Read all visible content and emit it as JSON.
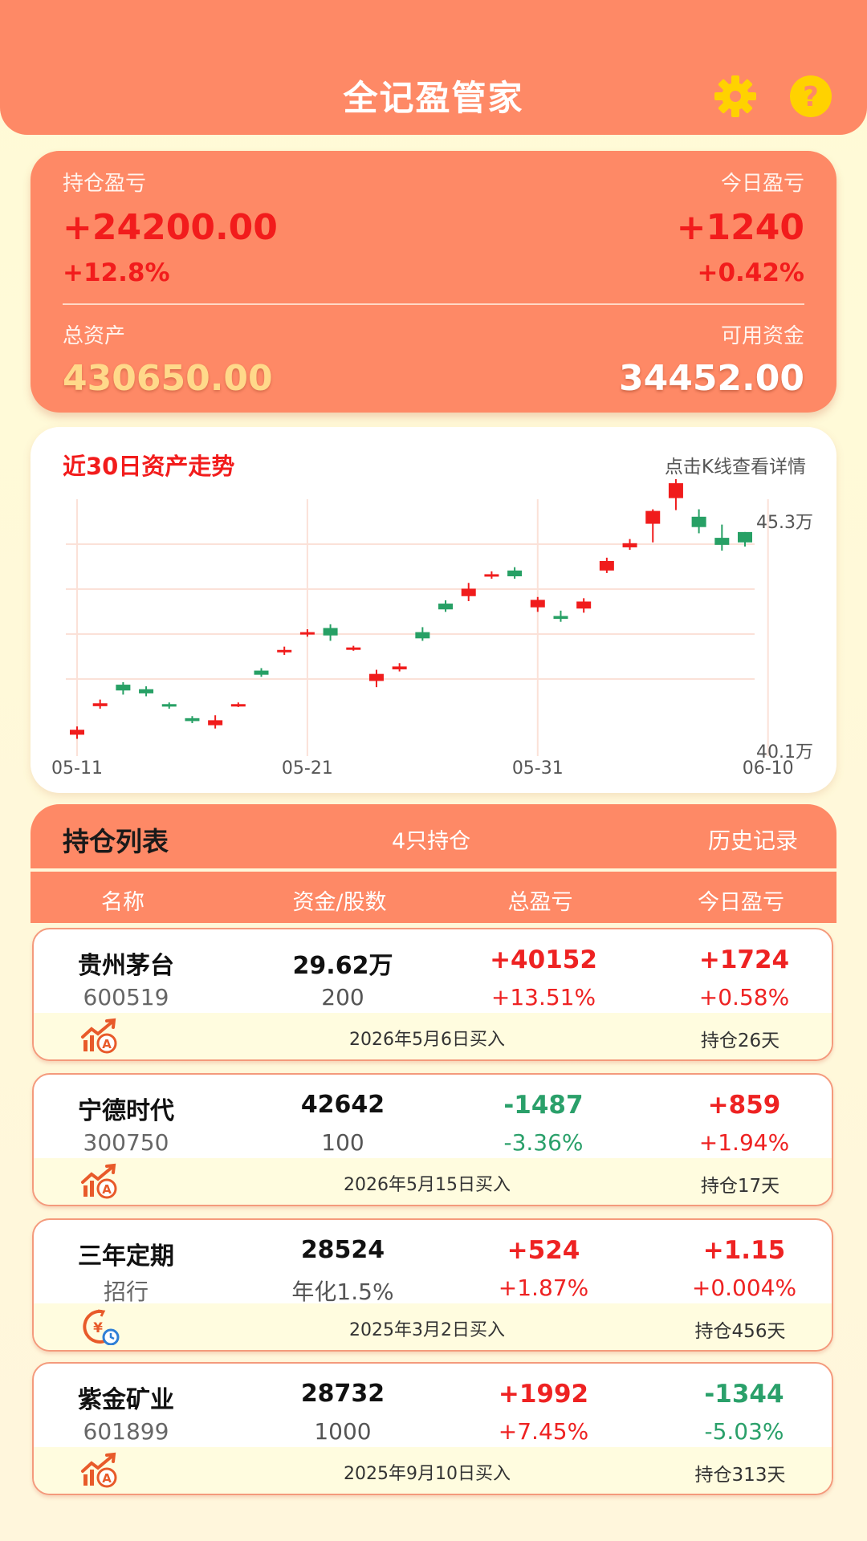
{
  "header": {
    "title": "全记盈管家",
    "settings_icon": "gear-icon",
    "help_icon": "question-icon",
    "icon_color": "#ffd200"
  },
  "summary": {
    "position_pl_label": "持仓盈亏",
    "position_pl_value": "+24200.00",
    "position_pl_pct": "+12.8%",
    "today_pl_label": "今日盈亏",
    "today_pl_value": "+1240",
    "today_pl_pct": "+0.42%",
    "total_assets_label": "总资产",
    "total_assets_value": "430650.00",
    "available_label": "可用资金",
    "available_value": "34452.00"
  },
  "chart": {
    "title": "近30日资产走势",
    "hint": "点击K线查看详情"
  },
  "chart_data": {
    "type": "candlestick",
    "y_unit": "万",
    "ylim": [
      40.1,
      45.3
    ],
    "y_tick_labels": [
      "45.3万",
      "40.1万"
    ],
    "x_tick_labels": [
      "05-11",
      "05-21",
      "05-31",
      "06-10"
    ],
    "x": [
      "05-11",
      "05-12",
      "05-13",
      "05-14",
      "05-15",
      "05-16",
      "05-17",
      "05-18",
      "05-19",
      "05-20",
      "05-21",
      "05-22",
      "05-23",
      "05-24",
      "05-25",
      "05-26",
      "05-27",
      "05-28",
      "05-29",
      "05-30",
      "05-31",
      "06-01",
      "06-02",
      "06-03",
      "06-04",
      "06-05",
      "06-06",
      "06-07",
      "06-08",
      "06-09",
      "06-10"
    ],
    "candles": [
      {
        "o": 40.15,
        "c": 40.27,
        "h": 40.35,
        "l": 40.05
      },
      {
        "o": 40.84,
        "c": 40.91,
        "h": 41.0,
        "l": 40.78
      },
      {
        "o": 41.36,
        "c": 41.22,
        "h": 41.42,
        "l": 41.12
      },
      {
        "o": 41.25,
        "c": 41.15,
        "h": 41.32,
        "l": 41.08
      },
      {
        "o": 40.89,
        "c": 40.83,
        "h": 40.93,
        "l": 40.78
      },
      {
        "o": 40.55,
        "c": 40.48,
        "h": 40.6,
        "l": 40.43
      },
      {
        "o": 40.38,
        "c": 40.5,
        "h": 40.62,
        "l": 40.3
      },
      {
        "o": 40.86,
        "c": 40.89,
        "h": 40.93,
        "l": 40.82
      },
      {
        "o": 41.7,
        "c": 41.6,
        "h": 41.76,
        "l": 41.55
      },
      {
        "o": 42.15,
        "c": 42.2,
        "h": 42.28,
        "l": 42.08
      },
      {
        "o": 42.58,
        "c": 42.63,
        "h": 42.7,
        "l": 42.52
      },
      {
        "o": 42.73,
        "c": 42.55,
        "h": 42.82,
        "l": 42.42
      },
      {
        "o": 42.22,
        "c": 42.26,
        "h": 42.3,
        "l": 42.18
      },
      {
        "o": 41.45,
        "c": 41.62,
        "h": 41.72,
        "l": 41.3
      },
      {
        "o": 41.73,
        "c": 41.8,
        "h": 41.88,
        "l": 41.68
      },
      {
        "o": 42.63,
        "c": 42.48,
        "h": 42.75,
        "l": 42.42
      },
      {
        "o": 43.32,
        "c": 43.18,
        "h": 43.4,
        "l": 43.12
      },
      {
        "o": 43.5,
        "c": 43.68,
        "h": 43.82,
        "l": 43.38
      },
      {
        "o": 44.0,
        "c": 44.03,
        "h": 44.1,
        "l": 43.92
      },
      {
        "o": 44.12,
        "c": 43.98,
        "h": 44.2,
        "l": 43.92
      },
      {
        "o": 43.23,
        "c": 43.41,
        "h": 43.48,
        "l": 43.12
      },
      {
        "o": 43.02,
        "c": 42.95,
        "h": 43.15,
        "l": 42.88
      },
      {
        "o": 43.2,
        "c": 43.37,
        "h": 43.45,
        "l": 43.1
      },
      {
        "o": 44.12,
        "c": 44.35,
        "h": 44.43,
        "l": 44.06
      },
      {
        "o": 44.68,
        "c": 44.78,
        "h": 44.88,
        "l": 44.62
      },
      {
        "o": 45.25,
        "c": 45.56,
        "h": 45.6,
        "l": 44.8
      },
      {
        "o": 45.87,
        "c": 46.23,
        "h": 46.33,
        "l": 45.58
      },
      {
        "o": 45.42,
        "c": 45.17,
        "h": 45.6,
        "l": 45.02
      },
      {
        "o": 44.91,
        "c": 44.74,
        "h": 45.23,
        "l": 44.6
      },
      {
        "o": 45.05,
        "c": 44.8,
        "h": 45.05,
        "l": 44.7
      }
    ],
    "colors": {
      "up": "#f01c1c",
      "down": "#27a065"
    },
    "grid": true
  },
  "positions": {
    "title": "持仓列表",
    "count": "4只持仓",
    "history": "历史记录",
    "columns": [
      "名称",
      "资金/股数",
      "总盈亏",
      "今日盈亏"
    ],
    "items": [
      {
        "name": "贵州茅台",
        "code": "600519",
        "amount": "29.62万",
        "shares": "200",
        "pl": "+40152",
        "pl_pct": "+13.51%",
        "pl_dir": "up",
        "today": "+1724",
        "today_pct": "+0.58%",
        "today_dir": "up",
        "date": "2026年5月6日买入",
        "days": "持仓26天",
        "icon": "stock-trend-icon"
      },
      {
        "name": "宁德时代",
        "code": "300750",
        "amount": "42642",
        "shares": "100",
        "pl": "-1487",
        "pl_pct": "-3.36%",
        "pl_dir": "down",
        "today": "+859",
        "today_pct": "+1.94%",
        "today_dir": "up",
        "date": "2026年5月15日买入",
        "days": "持仓17天",
        "icon": "stock-trend-icon"
      },
      {
        "name": "三年定期",
        "code": "招行",
        "amount": "28524",
        "shares": "年化1.5%",
        "pl": "+524",
        "pl_pct": "+1.87%",
        "pl_dir": "up",
        "today": "+1.15",
        "today_pct": "+0.004%",
        "today_dir": "up",
        "date": "2025年3月2日买入",
        "days": "持仓456天",
        "icon": "deposit-clock-icon"
      },
      {
        "name": "紫金矿业",
        "code": "601899",
        "amount": "28732",
        "shares": "1000",
        "pl": "+1992",
        "pl_pct": "+7.45%",
        "pl_dir": "up",
        "today": "-1344",
        "today_pct": "-5.03%",
        "today_dir": "down",
        "date": "2025年9月10日买入",
        "days": "持仓313天",
        "icon": "stock-trend-icon"
      }
    ]
  }
}
